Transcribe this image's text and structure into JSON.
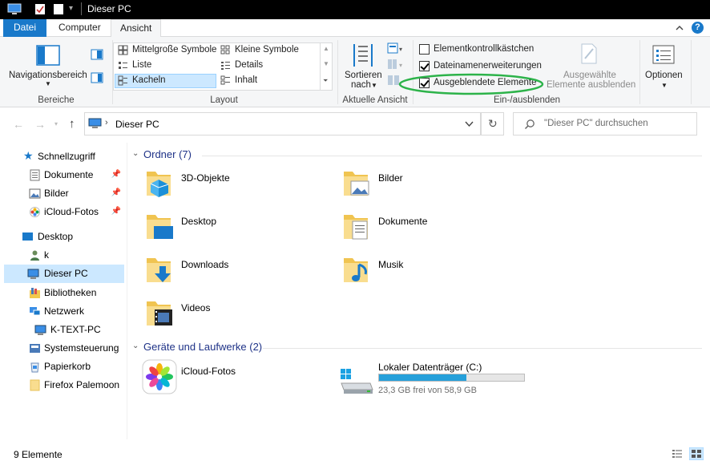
{
  "window": {
    "title": "Dieser PC"
  },
  "tabs": {
    "file": "Datei",
    "computer": "Computer",
    "view": "Ansicht"
  },
  "ribbon": {
    "panes": {
      "nav_pane": "Navigationsbereich",
      "group": "Bereiche"
    },
    "layout": {
      "items": [
        "Mittelgroße Symbole",
        "Kleine Symbole",
        "Liste",
        "Details",
        "Kacheln",
        "Inhalt"
      ],
      "selected": "Kacheln",
      "group": "Layout"
    },
    "current_view": {
      "sort_line1": "Sortieren",
      "sort_line2": "nach",
      "group": "Aktuelle Ansicht"
    },
    "show_hide": {
      "checkbox_items": "Elementkontrollkästchen",
      "file_extensions": "Dateinamenerweiterungen",
      "hidden_items": "Ausgeblendete Elemente",
      "checked": {
        "checkbox_items": false,
        "file_extensions": true,
        "hidden_items": true
      },
      "hide_selected_line1": "Ausgewählte",
      "hide_selected_line2": "Elemente ausblenden",
      "group": "Ein-/ausblenden"
    },
    "options": "Optionen"
  },
  "address": {
    "location": "Dieser PC",
    "search_placeholder": "\"Dieser PC\" durchsuchen"
  },
  "sidebar": {
    "items": [
      {
        "label": "Schnellzugriff",
        "icon": "star-icon"
      },
      {
        "label": "Dokumente",
        "icon": "documents-icon",
        "pinned": true
      },
      {
        "label": "Bilder",
        "icon": "pictures-icon",
        "pinned": true
      },
      {
        "label": "iCloud-Fotos",
        "icon": "icloud-photos-icon",
        "pinned": true
      },
      {
        "label": "Desktop",
        "icon": "desktop-icon"
      },
      {
        "label": "k",
        "icon": "user-icon"
      },
      {
        "label": "Dieser PC",
        "icon": "computer-icon",
        "selected": true
      },
      {
        "label": "Bibliotheken",
        "icon": "libraries-icon"
      },
      {
        "label": "Netzwerk",
        "icon": "network-icon"
      },
      {
        "label": "K-TEXT-PC",
        "icon": "computer-icon"
      },
      {
        "label": "Systemsteuerung",
        "icon": "control-panel-icon"
      },
      {
        "label": "Papierkorb",
        "icon": "recycle-bin-icon"
      },
      {
        "label": "Firefox Palemoon",
        "icon": "folder-icon"
      }
    ]
  },
  "content": {
    "folders_header": "Ordner (7)",
    "folders": [
      "3D-Objekte",
      "Bilder",
      "Desktop",
      "Dokumente",
      "Downloads",
      "Musik",
      "Videos"
    ],
    "devices_header": "Geräte und Laufwerke (2)",
    "devices": {
      "icloud": "iCloud-Fotos",
      "drive_name": "Lokaler Datenträger (C:)",
      "drive_free": "23,3 GB frei von 58,9 GB",
      "drive_used_fraction": 0.6
    }
  },
  "status": {
    "count": "9 Elemente"
  },
  "colors": {
    "accent": "#1979ca",
    "selection": "#cce8ff",
    "annotation": "#2db34a",
    "drive_bar": "#26a0da"
  }
}
